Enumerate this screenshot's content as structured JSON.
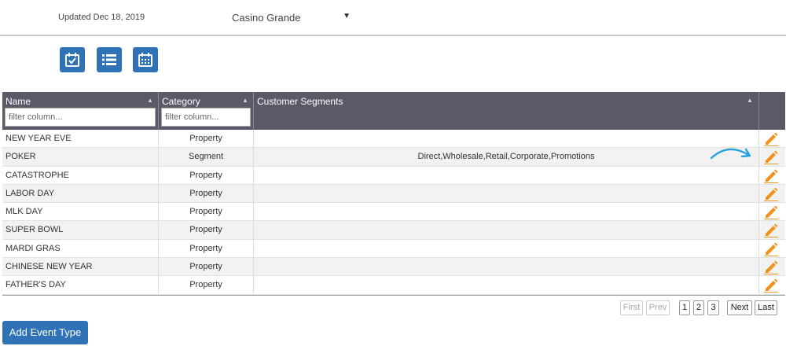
{
  "header": {
    "updated_text": "Updated Dec 18, 2019",
    "property_select": {
      "value": "Casino Grande",
      "arrow": "▼"
    }
  },
  "toolbar": {
    "buttons": [
      {
        "icon": "calendar-check-icon"
      },
      {
        "icon": "list-icon"
      },
      {
        "icon": "calendar-grid-icon"
      }
    ]
  },
  "grid": {
    "columns": [
      {
        "title": "Name",
        "filter_placeholder": "filter column..."
      },
      {
        "title": "Category",
        "filter_placeholder": "filter column..."
      },
      {
        "title": "Customer Segments"
      }
    ],
    "rows": [
      {
        "name": "NEW YEAR EVE",
        "category": "Property",
        "segments": ""
      },
      {
        "name": "POKER",
        "category": "Segment",
        "segments": "Direct,Wholesale,Retail,Corporate,Promotions"
      },
      {
        "name": "CATASTROPHE",
        "category": "Property",
        "segments": ""
      },
      {
        "name": "LABOR DAY",
        "category": "Property",
        "segments": ""
      },
      {
        "name": "MLK DAY",
        "category": "Property",
        "segments": ""
      },
      {
        "name": "SUPER BOWL",
        "category": "Property",
        "segments": ""
      },
      {
        "name": "MARDI GRAS",
        "category": "Property",
        "segments": ""
      },
      {
        "name": "CHINESE NEW YEAR",
        "category": "Property",
        "segments": ""
      },
      {
        "name": "FATHER'S DAY",
        "category": "Property",
        "segments": ""
      }
    ],
    "edit_icon": "pencil-icon"
  },
  "pagination": {
    "first": "First",
    "prev": "Prev",
    "pages": [
      "1",
      "2",
      "3"
    ],
    "next": "Next",
    "last": "Last"
  },
  "add_button": {
    "label": "Add Event Type"
  },
  "colors": {
    "accent": "#2f73b6",
    "header_bg": "#5c5868",
    "edit_icon": "#f0931e",
    "hint_arrow": "#29a3dd"
  }
}
